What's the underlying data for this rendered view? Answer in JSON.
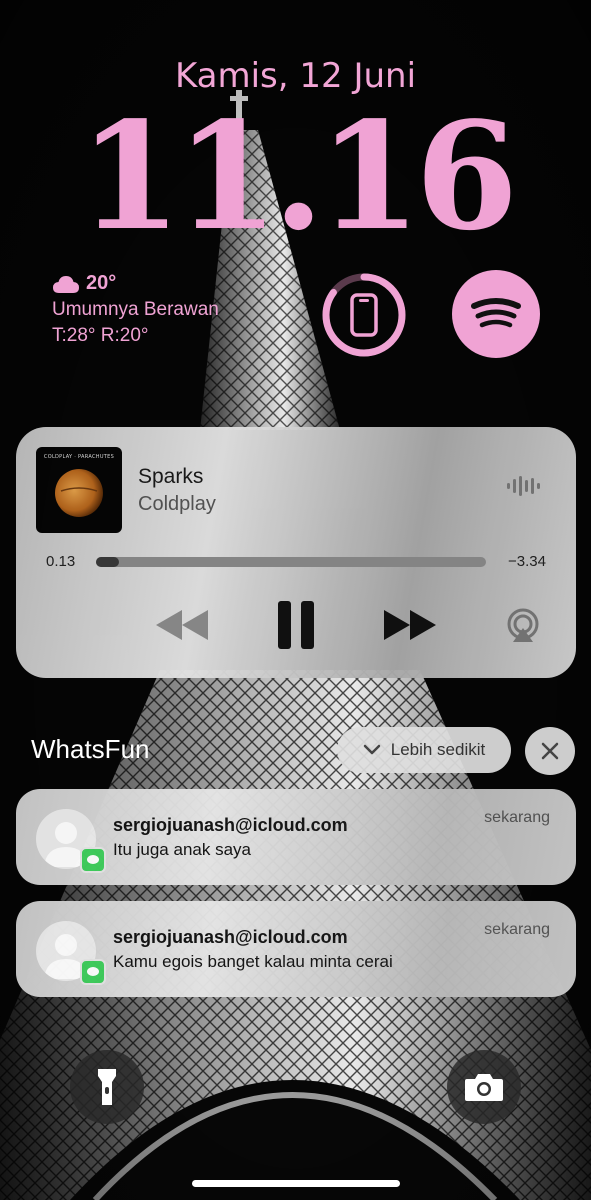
{
  "lockscreen": {
    "date": "Kamis, 12 Juni",
    "time": "11.16",
    "accent_color": "#f0a3d4"
  },
  "weather": {
    "icon": "cloud-icon",
    "temperature": "20°",
    "condition": "Umumnya Berawan",
    "high_low": "T:28° R:20°"
  },
  "widgets": {
    "battery_icon": "phone-icon",
    "battery_level": 0.85,
    "spotify_icon": "spotify-icon"
  },
  "now_playing": {
    "album_caption": "COLDPLAY · PARACHUTES",
    "title": "Sparks",
    "artist": "Coldplay",
    "elapsed": "0.13",
    "remaining": "−3.34",
    "progress": 0.06,
    "controls": [
      "rewind-icon",
      "pause-icon",
      "forward-icon",
      "airplay-icon"
    ]
  },
  "notifications": {
    "app_name": "WhatsFun",
    "collapse_label": "Lebih sedikit",
    "items": [
      {
        "sender": "sergiojuanash@icloud.com",
        "message": "Itu juga anak saya",
        "time": "sekarang"
      },
      {
        "sender": "sergiojuanash@icloud.com",
        "message": "Kamu egois banget kalau minta cerai",
        "time": "sekarang"
      }
    ]
  },
  "quick_actions": {
    "left": "flashlight-icon",
    "right": "camera-icon"
  }
}
